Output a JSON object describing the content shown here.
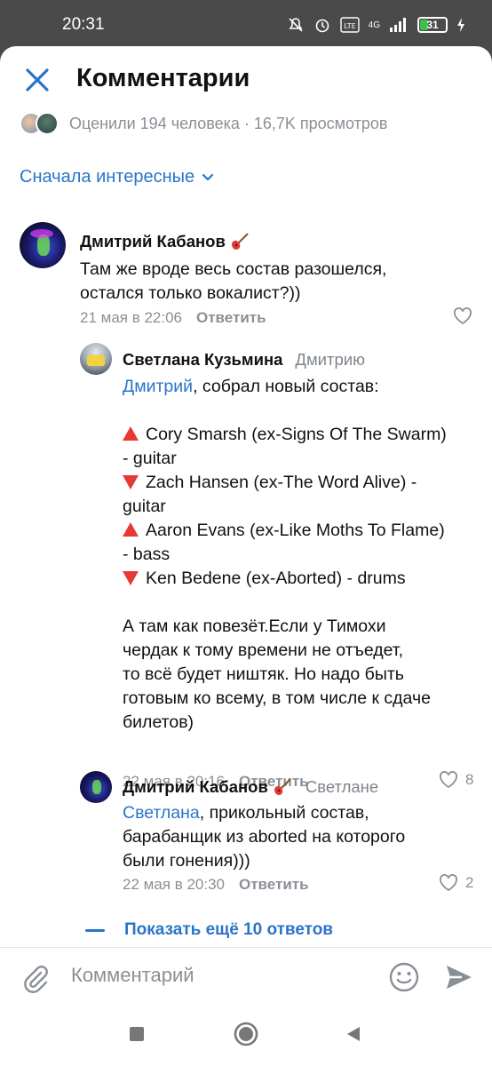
{
  "status": {
    "time": "20:31",
    "battery": "31",
    "network": "4G"
  },
  "header": {
    "title": "Комментарии"
  },
  "stats": {
    "text": "Оценили 194 человека · 16,7K просмотров"
  },
  "sort": {
    "label": "Сначала интересные"
  },
  "comments": [
    {
      "author": "Дмитрий Кабанов",
      "text": "Там же вроде весь состав разошелся, остался только вокалист?))",
      "date": "21 мая в 22:06",
      "reply_label": "Ответить",
      "likes": ""
    },
    {
      "author": "Светлана Кузьмина",
      "to": "Дмитрию",
      "mention": "Дмитрий",
      "intro": ", собрал новый состав:",
      "lineup": [
        "Cory Smarsh (ex-Signs Of The Swarm)",
        "- guitar",
        "Zach Hansen (ex-The Word Alive) -",
        "guitar",
        "Aaron Evans (ex-Like Moths To Flame)",
        "- bass",
        "Ken Bedene (ex-Aborted) - drums"
      ],
      "outro": [
        "А там как повезёт.Если у Тимохи",
        "чердак к тому времени не отъедет,",
        "то всё будет ништяк. Но надо быть",
        "готовым ко всему, в том числе к сдаче",
        "билетов)"
      ],
      "date": "22 мая в 20:16",
      "reply_label": "Ответить",
      "likes": "8"
    },
    {
      "author": "Дмитрий Кабанов",
      "to": "Светлане",
      "mention": "Светлана",
      "lines": [
        ", прикольный состав,",
        "барабанщик из aborted на которого",
        "были гонения)))"
      ],
      "date": "22 мая в 20:30",
      "reply_label": "Ответить",
      "likes": "2"
    }
  ],
  "show_more": {
    "label": "Показать ещё 10 ответов"
  },
  "composer": {
    "placeholder": "Комментарий"
  },
  "icons": {
    "close": "close-icon",
    "chevron": "chevron-down-icon",
    "heart": "heart-icon",
    "guitar": "guitar-icon",
    "clip": "paperclip-icon",
    "smile": "smile-icon",
    "send": "send-icon"
  },
  "colors": {
    "accent": "#2a74c9",
    "triangle": "#e53935",
    "muted": "#8a8f96"
  }
}
